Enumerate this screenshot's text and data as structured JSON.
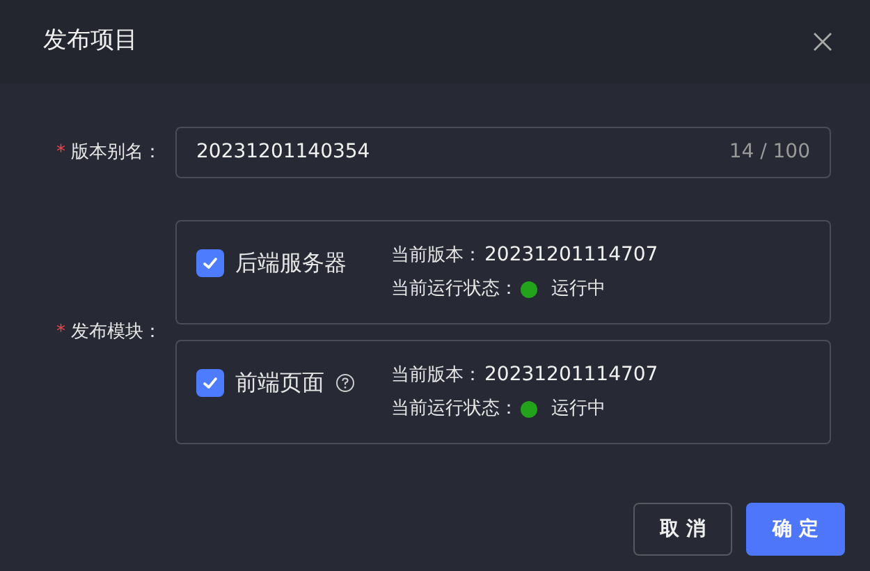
{
  "dialog": {
    "title": "发布项目"
  },
  "alias_field": {
    "required_mark": "*",
    "label": "版本别名：",
    "value": "20231201140354",
    "counter": "14 / 100"
  },
  "modules_field": {
    "required_mark": "*",
    "label": "发布模块：",
    "modules": [
      {
        "name": "后端服务器",
        "checked": true,
        "has_help": false,
        "version_label": "当前版本：",
        "version": "20231201114707",
        "status_label": "当前运行状态：",
        "status": "运行中",
        "color": "#22a31b"
      },
      {
        "name": "前端页面",
        "checked": true,
        "has_help": true,
        "version_label": "当前版本：",
        "version": "20231201114707",
        "status_label": "当前运行状态：",
        "status": "运行中",
        "color": "#22a31b"
      }
    ]
  },
  "buttons": [
    {
      "kind": "secondary",
      "label": "取 消"
    },
    {
      "kind": "primary",
      "label": "确 定"
    }
  ]
}
